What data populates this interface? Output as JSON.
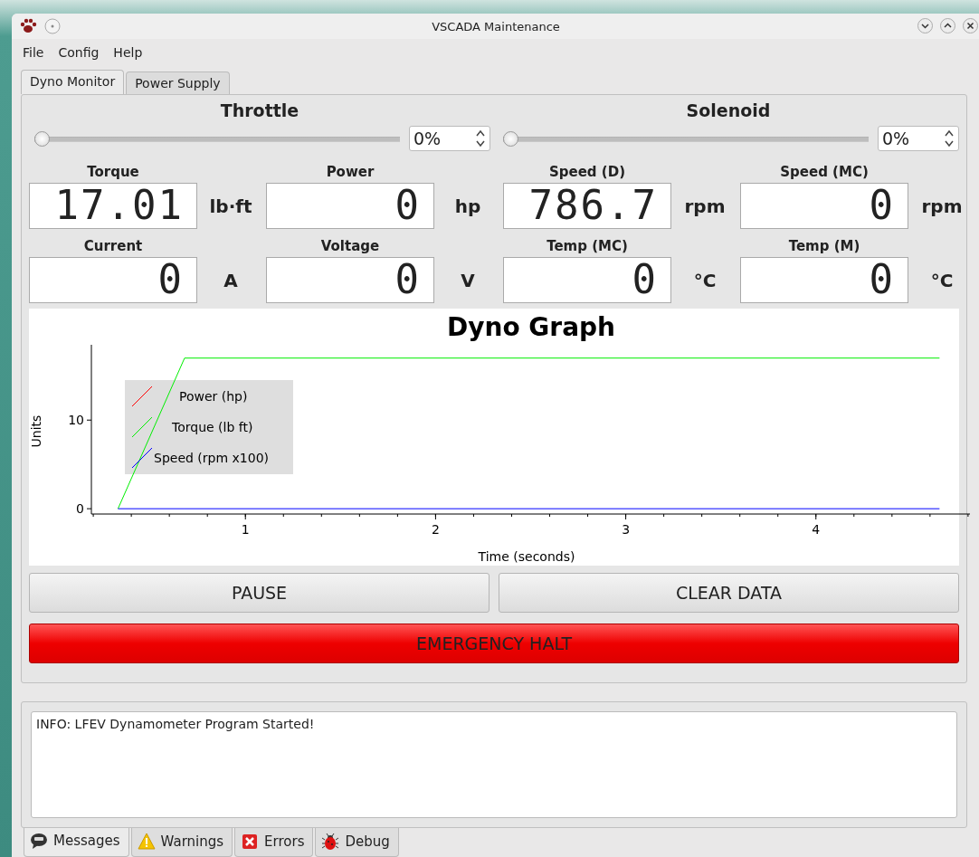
{
  "window": {
    "title": "VSCADA Maintenance"
  },
  "menu": [
    "File",
    "Config",
    "Help"
  ],
  "tabs": [
    {
      "label": "Dyno Monitor",
      "selected": true
    },
    {
      "label": "Power Supply",
      "selected": false
    }
  ],
  "sliders": [
    {
      "label": "Throttle",
      "level": 0,
      "reading": "0%"
    },
    {
      "label": "Solenoid",
      "level": 0,
      "reading": "0%"
    }
  ],
  "readouts": [
    {
      "label": "Torque",
      "value": "17.01",
      "unit": "lb·ft"
    },
    {
      "label": "Power",
      "value": "0",
      "unit": "hp"
    },
    {
      "label": "Speed (D)",
      "value": "786.7",
      "unit": "rpm"
    },
    {
      "label": "Speed (MC)",
      "value": "0",
      "unit": "rpm"
    },
    {
      "label": "Current",
      "value": "0",
      "unit": "A"
    },
    {
      "label": "Voltage",
      "value": "0",
      "unit": "V"
    },
    {
      "label": "Temp (MC)",
      "value": "0",
      "unit": "°C"
    },
    {
      "label": "Temp (M)",
      "value": "0",
      "unit": "°C"
    }
  ],
  "graph": {
    "chart_data": {
      "type": "line",
      "title": "Dyno Graph",
      "xlabel": "Time (seconds)",
      "ylabel": "Units",
      "x": [
        0.33,
        0.68,
        4.65
      ],
      "xlim": [
        0.19,
        4.81
      ],
      "ylim": [
        -0.6,
        18.5
      ],
      "legend": "upper left",
      "xticks": [
        1,
        2,
        3,
        4
      ],
      "yticks": [
        0,
        10
      ],
      "series": [
        {
          "name": "Power (hp)",
          "color": "#ff0000",
          "values": [
            null,
            null,
            null
          ]
        },
        {
          "name": "Torque (lb ft)",
          "color": "#00ee00",
          "values": [
            0,
            17,
            17
          ]
        },
        {
          "name": "Speed (rpm x100)",
          "color": "#0000ff",
          "values": [
            0,
            0,
            0
          ]
        }
      ]
    }
  },
  "buttons": [
    "PAUSE",
    "CLEAR DATA"
  ],
  "emergency_button": "EMERGENCY HALT",
  "log": [
    "INFO: LFEV Dynamometer Program Started!"
  ],
  "log_tabs": [
    {
      "label": "Messages",
      "kind": "messages",
      "selected": true
    },
    {
      "label": "Warnings",
      "kind": "warning",
      "selected": false
    },
    {
      "label": "Errors",
      "kind": "error",
      "selected": false
    },
    {
      "label": "Debug",
      "kind": "debug",
      "selected": false
    }
  ]
}
